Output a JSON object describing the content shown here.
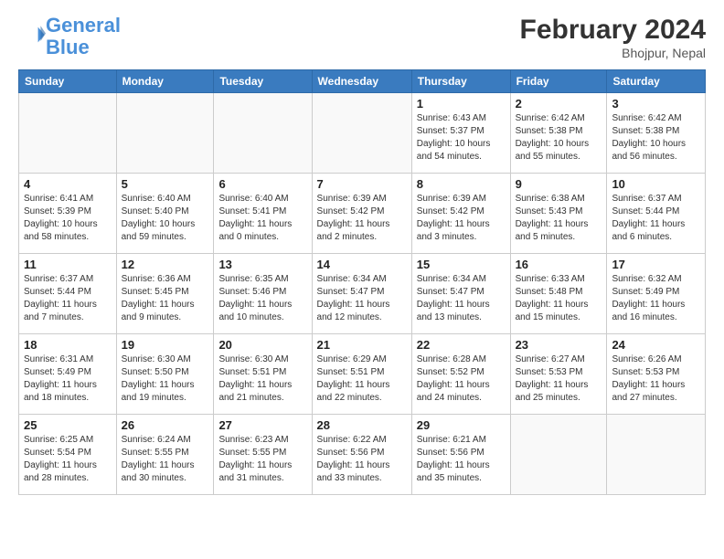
{
  "header": {
    "logo_line1": "General",
    "logo_line2": "Blue",
    "month_year": "February 2024",
    "location": "Bhojpur, Nepal"
  },
  "days_of_week": [
    "Sunday",
    "Monday",
    "Tuesday",
    "Wednesday",
    "Thursday",
    "Friday",
    "Saturday"
  ],
  "weeks": [
    [
      {
        "day": "",
        "info": ""
      },
      {
        "day": "",
        "info": ""
      },
      {
        "day": "",
        "info": ""
      },
      {
        "day": "",
        "info": ""
      },
      {
        "day": "1",
        "info": "Sunrise: 6:43 AM\nSunset: 5:37 PM\nDaylight: 10 hours and 54 minutes."
      },
      {
        "day": "2",
        "info": "Sunrise: 6:42 AM\nSunset: 5:38 PM\nDaylight: 10 hours and 55 minutes."
      },
      {
        "day": "3",
        "info": "Sunrise: 6:42 AM\nSunset: 5:38 PM\nDaylight: 10 hours and 56 minutes."
      }
    ],
    [
      {
        "day": "4",
        "info": "Sunrise: 6:41 AM\nSunset: 5:39 PM\nDaylight: 10 hours and 58 minutes."
      },
      {
        "day": "5",
        "info": "Sunrise: 6:40 AM\nSunset: 5:40 PM\nDaylight: 10 hours and 59 minutes."
      },
      {
        "day": "6",
        "info": "Sunrise: 6:40 AM\nSunset: 5:41 PM\nDaylight: 11 hours and 0 minutes."
      },
      {
        "day": "7",
        "info": "Sunrise: 6:39 AM\nSunset: 5:42 PM\nDaylight: 11 hours and 2 minutes."
      },
      {
        "day": "8",
        "info": "Sunrise: 6:39 AM\nSunset: 5:42 PM\nDaylight: 11 hours and 3 minutes."
      },
      {
        "day": "9",
        "info": "Sunrise: 6:38 AM\nSunset: 5:43 PM\nDaylight: 11 hours and 5 minutes."
      },
      {
        "day": "10",
        "info": "Sunrise: 6:37 AM\nSunset: 5:44 PM\nDaylight: 11 hours and 6 minutes."
      }
    ],
    [
      {
        "day": "11",
        "info": "Sunrise: 6:37 AM\nSunset: 5:44 PM\nDaylight: 11 hours and 7 minutes."
      },
      {
        "day": "12",
        "info": "Sunrise: 6:36 AM\nSunset: 5:45 PM\nDaylight: 11 hours and 9 minutes."
      },
      {
        "day": "13",
        "info": "Sunrise: 6:35 AM\nSunset: 5:46 PM\nDaylight: 11 hours and 10 minutes."
      },
      {
        "day": "14",
        "info": "Sunrise: 6:34 AM\nSunset: 5:47 PM\nDaylight: 11 hours and 12 minutes."
      },
      {
        "day": "15",
        "info": "Sunrise: 6:34 AM\nSunset: 5:47 PM\nDaylight: 11 hours and 13 minutes."
      },
      {
        "day": "16",
        "info": "Sunrise: 6:33 AM\nSunset: 5:48 PM\nDaylight: 11 hours and 15 minutes."
      },
      {
        "day": "17",
        "info": "Sunrise: 6:32 AM\nSunset: 5:49 PM\nDaylight: 11 hours and 16 minutes."
      }
    ],
    [
      {
        "day": "18",
        "info": "Sunrise: 6:31 AM\nSunset: 5:49 PM\nDaylight: 11 hours and 18 minutes."
      },
      {
        "day": "19",
        "info": "Sunrise: 6:30 AM\nSunset: 5:50 PM\nDaylight: 11 hours and 19 minutes."
      },
      {
        "day": "20",
        "info": "Sunrise: 6:30 AM\nSunset: 5:51 PM\nDaylight: 11 hours and 21 minutes."
      },
      {
        "day": "21",
        "info": "Sunrise: 6:29 AM\nSunset: 5:51 PM\nDaylight: 11 hours and 22 minutes."
      },
      {
        "day": "22",
        "info": "Sunrise: 6:28 AM\nSunset: 5:52 PM\nDaylight: 11 hours and 24 minutes."
      },
      {
        "day": "23",
        "info": "Sunrise: 6:27 AM\nSunset: 5:53 PM\nDaylight: 11 hours and 25 minutes."
      },
      {
        "day": "24",
        "info": "Sunrise: 6:26 AM\nSunset: 5:53 PM\nDaylight: 11 hours and 27 minutes."
      }
    ],
    [
      {
        "day": "25",
        "info": "Sunrise: 6:25 AM\nSunset: 5:54 PM\nDaylight: 11 hours and 28 minutes."
      },
      {
        "day": "26",
        "info": "Sunrise: 6:24 AM\nSunset: 5:55 PM\nDaylight: 11 hours and 30 minutes."
      },
      {
        "day": "27",
        "info": "Sunrise: 6:23 AM\nSunset: 5:55 PM\nDaylight: 11 hours and 31 minutes."
      },
      {
        "day": "28",
        "info": "Sunrise: 6:22 AM\nSunset: 5:56 PM\nDaylight: 11 hours and 33 minutes."
      },
      {
        "day": "29",
        "info": "Sunrise: 6:21 AM\nSunset: 5:56 PM\nDaylight: 11 hours and 35 minutes."
      },
      {
        "day": "",
        "info": ""
      },
      {
        "day": "",
        "info": ""
      }
    ]
  ]
}
